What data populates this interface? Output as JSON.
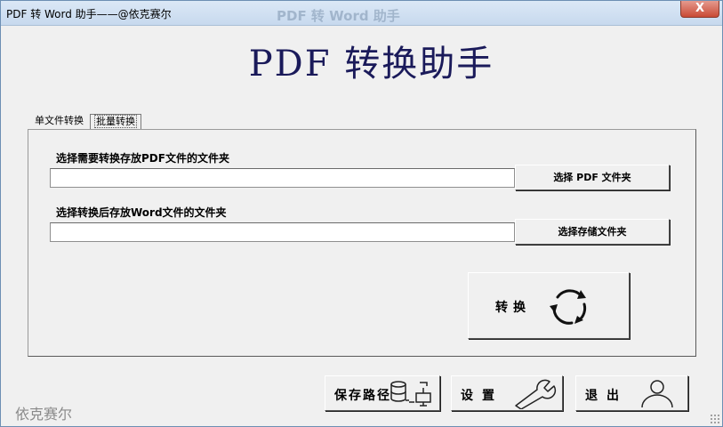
{
  "window": {
    "title": "PDF 转 Word 助手——@依克赛尔",
    "ghost_title": "PDF 转 Word 助手",
    "close_label": "X"
  },
  "app": {
    "title": "PDF 转换助手"
  },
  "tabs": [
    {
      "label": "单文件转换",
      "selected": false
    },
    {
      "label": "批量转换",
      "selected": true
    }
  ],
  "batch": {
    "source_label": "选择需要转换存放PDF文件的文件夹",
    "source_value": "",
    "source_button": "选择 PDF 文件夹",
    "target_label": "选择转换后存放Word文件的文件夹",
    "target_value": "",
    "target_button": "选择存储文件夹",
    "convert_label": "转换"
  },
  "footer": {
    "save_path_label": "保存路径",
    "settings_label": "设置",
    "exit_label": "退出"
  },
  "watermark": "依克赛尔",
  "icons": {
    "convert": "refresh-cycle-icon",
    "save_path": "database-network-icon",
    "settings": "wrench-icon",
    "exit": "user-icon"
  }
}
